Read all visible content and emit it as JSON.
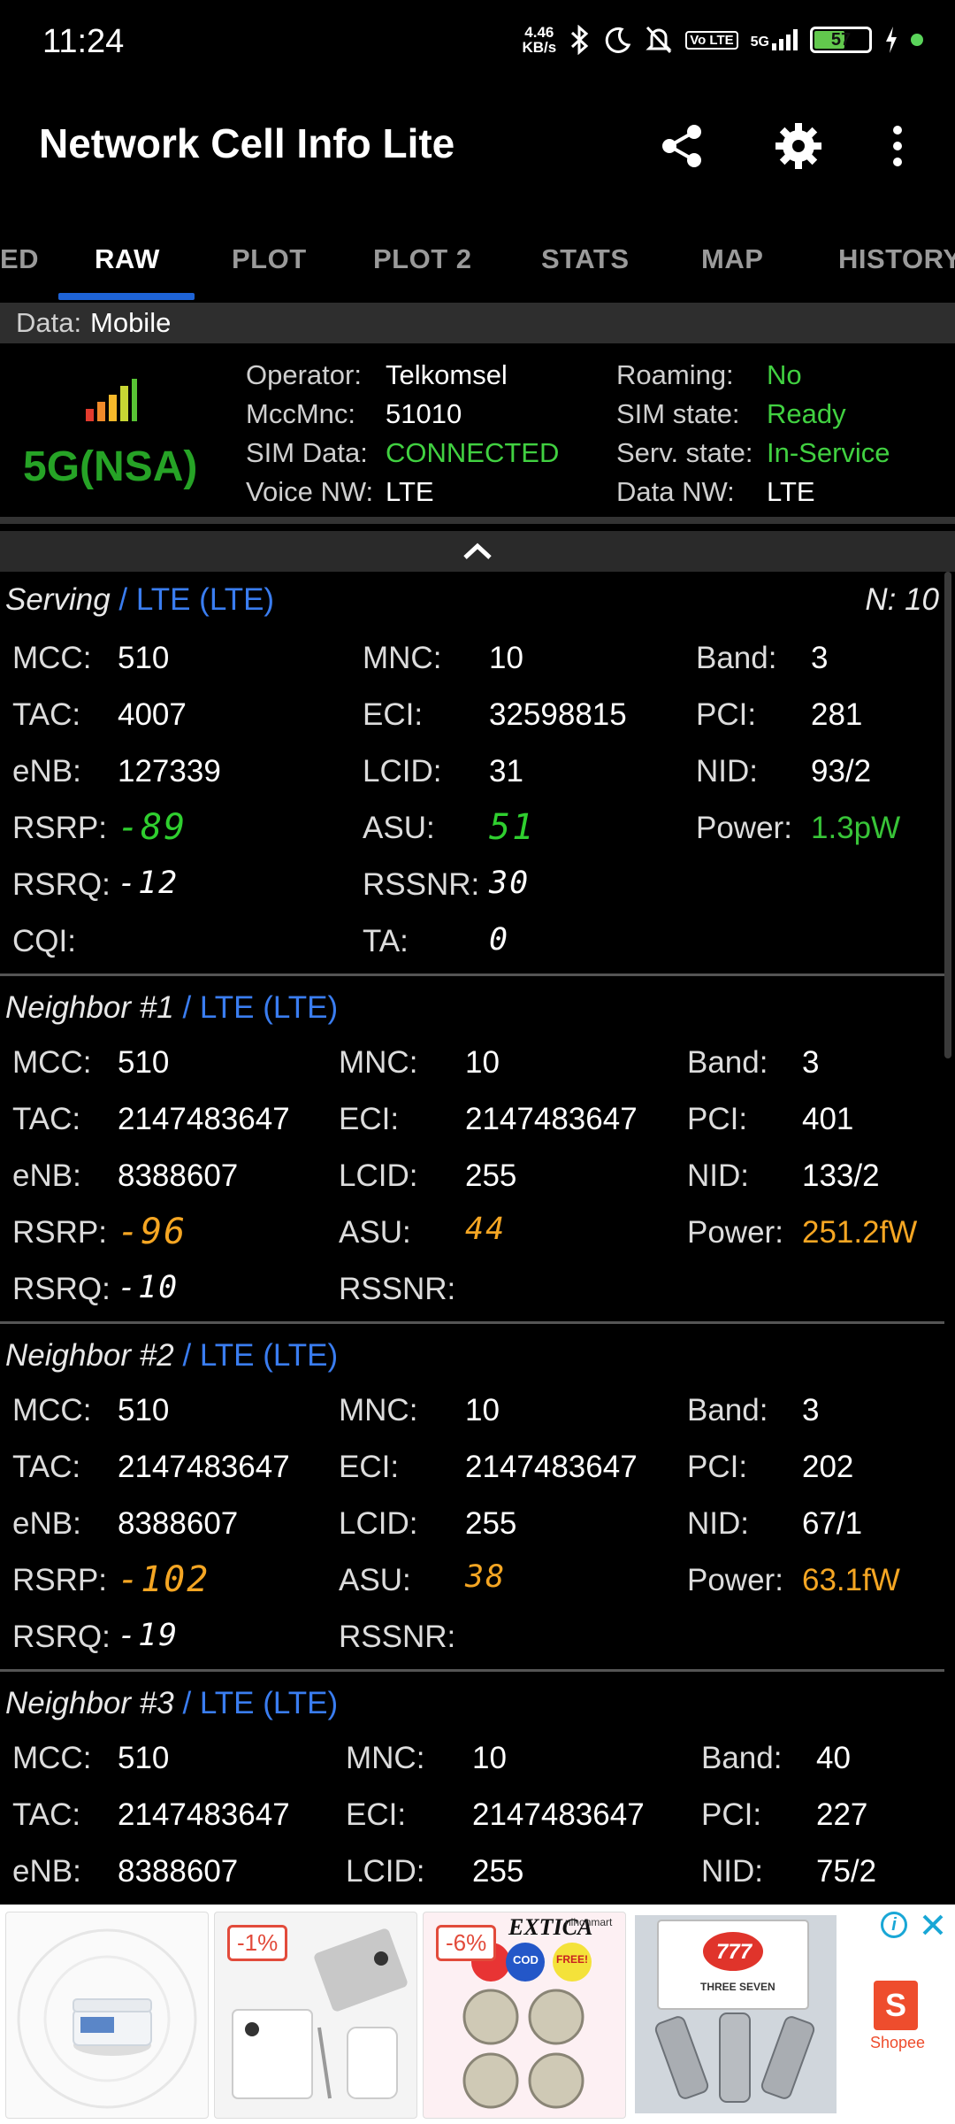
{
  "status_bar": {
    "time": "11:24",
    "speed_value": "4.46",
    "speed_unit": "KB/s",
    "volte": "Vo LTE",
    "network": "5G",
    "battery": "57",
    "battery_level": 0.57
  },
  "app_bar": {
    "title": "Network Cell Info Lite",
    "icons": [
      "share-icon",
      "gear-icon",
      "more-vert-icon"
    ]
  },
  "tabs": [
    "ED",
    "RAW",
    "PLOT",
    "PLOT 2",
    "STATS",
    "MAP",
    "HISTORY"
  ],
  "active_tab": "RAW",
  "data_source": {
    "label": "Data:",
    "value": "Mobile"
  },
  "summary": {
    "network_type": "5G(NSA)",
    "operator": {
      "label": "Operator:",
      "value": "Telkomsel"
    },
    "mccmnc": {
      "label": "MccMnc:",
      "value": "51010"
    },
    "sim_data": {
      "label": "SIM Data:",
      "value": "CONNECTED"
    },
    "voice_nw": {
      "label": "Voice NW:",
      "value": "LTE"
    },
    "roaming": {
      "label": "Roaming:",
      "value": "No"
    },
    "sim_state": {
      "label": "SIM state:",
      "value": "Ready"
    },
    "serv_state": {
      "label": "Serv. state:",
      "value": "In-Service"
    },
    "data_nw": {
      "label": "Data NW:",
      "value": "LTE"
    }
  },
  "labels": {
    "mcc": "MCC:",
    "mnc": "MNC:",
    "band": "Band:",
    "tac": "TAC:",
    "eci": "ECI:",
    "pci": "PCI:",
    "enb": "eNB:",
    "lcid": "LCID:",
    "nid": "NID:",
    "rsrp": "RSRP:",
    "asu": "ASU:",
    "power": "Power:",
    "rsrq": "RSRQ:",
    "rssnr": "RSSNR:",
    "cqi": "CQI:",
    "ta": "TA:"
  },
  "serving": {
    "title": "Serving",
    "tech": "/ LTE (LTE)",
    "n_count": "N: 10",
    "mcc": "510",
    "mnc": "10",
    "band": "3",
    "tac": "4007",
    "eci": "32598815",
    "pci": "281",
    "enb": "127339",
    "lcid": "31",
    "nid": "93/2",
    "rsrp": "-89",
    "asu": "51",
    "power": "1.3pW",
    "rsrq": "-12",
    "rssnr": "30",
    "cqi": "",
    "ta": "0"
  },
  "neighbors": [
    {
      "title": "Neighbor #1",
      "tech": "/ LTE (LTE)",
      "mcc": "510",
      "mnc": "10",
      "band": "3",
      "tac": "2147483647",
      "eci": "2147483647",
      "pci": "401",
      "enb": "8388607",
      "lcid": "255",
      "nid": "133/2",
      "rsrp": "-96",
      "asu": "44",
      "power": "251.2fW",
      "rsrq": "-10",
      "rssnr": ""
    },
    {
      "title": "Neighbor #2",
      "tech": "/ LTE (LTE)",
      "mcc": "510",
      "mnc": "10",
      "band": "3",
      "tac": "2147483647",
      "eci": "2147483647",
      "pci": "202",
      "enb": "8388607",
      "lcid": "255",
      "nid": "67/1",
      "rsrp": "-102",
      "asu": "38",
      "power": "63.1fW",
      "rsrq": "-19",
      "rssnr": ""
    },
    {
      "title": "Neighbor #3",
      "tech": "/ LTE (LTE)",
      "mcc": "510",
      "mnc": "10",
      "band": "40",
      "tac": "2147483647",
      "eci": "2147483647",
      "pci": "227",
      "enb": "8388607",
      "lcid": "255",
      "nid": "75/2"
    }
  ],
  "ads": {
    "badge_1": "-1%",
    "badge_2": "-6%",
    "brand_2": "EXTICA",
    "brand_2b": "nihonmart",
    "cod": "COD",
    "free": "FREE!",
    "brand_3": "777",
    "brand_3b": "THREE SEVEN",
    "shop": "Shopee"
  },
  "colors": {
    "accent": "#1e63d6",
    "good": "#41d141",
    "warn": "#f5a623",
    "link": "#3a7df0"
  }
}
